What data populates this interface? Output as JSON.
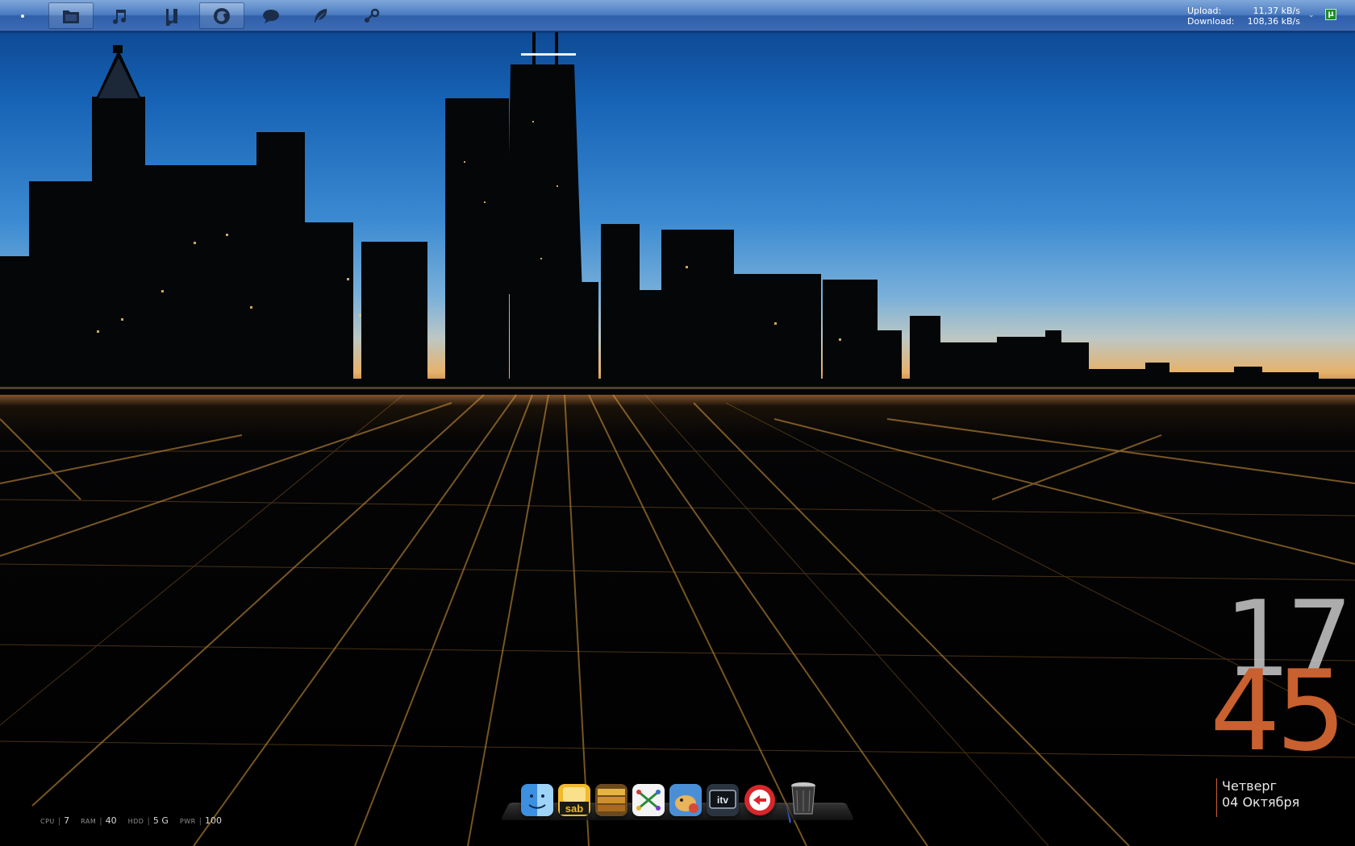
{
  "topbar": {
    "launcher_icons": [
      {
        "name": "files-icon",
        "active": true
      },
      {
        "name": "music-icon",
        "active": false
      },
      {
        "name": "utorrent-icon",
        "active": false
      },
      {
        "name": "firefox-icon",
        "active": true
      },
      {
        "name": "chat-icon",
        "active": false
      },
      {
        "name": "feather-icon",
        "active": false
      },
      {
        "name": "steam-icon",
        "active": false
      }
    ],
    "network": {
      "upload_label": "Upload:",
      "upload_value": "11,37 kB/s",
      "download_label": "Download:",
      "download_value": "108,36 kB/s"
    },
    "chevron": "⌄",
    "utorrent_tray": "μ"
  },
  "clock": {
    "hour": "17",
    "minute": "45",
    "weekday": "Четверг",
    "date": "04 Октября"
  },
  "stats": [
    {
      "label": "CPU",
      "value": "7"
    },
    {
      "label": "RAM",
      "value": "40"
    },
    {
      "label": "HDD",
      "value": "5 G"
    },
    {
      "label": "PWR",
      "value": "100"
    }
  ],
  "dock": {
    "items": [
      "finder-icon",
      "sabnzbd-icon",
      "archive-icon",
      "network-app-icon",
      "cyberduck-icon",
      "itv-icon",
      "redapp-icon",
      "trash-icon"
    ],
    "sab_text": "sab",
    "itv_text": "itv"
  },
  "colors": {
    "topbar": "#3d6cb4",
    "clock_accent": "#c8602f",
    "clock_hour": "#d2d2d2"
  }
}
